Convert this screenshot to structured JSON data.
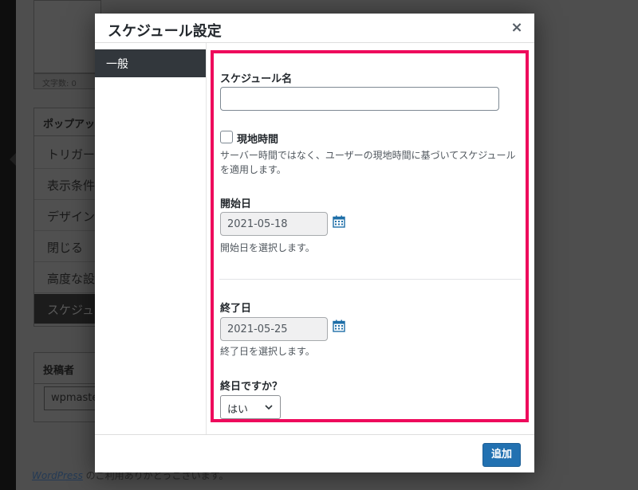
{
  "background": {
    "word_count": "文字数: 0",
    "popup_box_title": "ポップアップ",
    "tabs": [
      "トリガー",
      "表示条件",
      "デザイン",
      "閉じる",
      "高度な設",
      "スケジュ"
    ],
    "author_title": "投稿者",
    "author_value": "wpmaster",
    "footer_link": "WordPress",
    "footer_text": " のご利用ありがとうございます。"
  },
  "modal": {
    "title": "スケジュール設定",
    "close_icon": "×",
    "sidebar": {
      "items": [
        {
          "label": "一般"
        }
      ]
    },
    "fields": {
      "schedule_name": {
        "label": "スケジュール名",
        "value": ""
      },
      "local_time": {
        "label": "現地時間",
        "checked": false,
        "description": "サーバー時間ではなく、ユーザーの現地時間に基づいてスケジュールを適用します。"
      },
      "start_date": {
        "label": "開始日",
        "value": "2021-05-18",
        "description": "開始日を選択します。"
      },
      "end_date": {
        "label": "終了日",
        "value": "2021-05-25",
        "description": "終了日を選択します。"
      },
      "all_day": {
        "label": "終日ですか？",
        "selected": "はい"
      }
    },
    "add_button": "追加",
    "icons": {
      "calendar": "calendar-icon",
      "chevron": "chevron-down-icon",
      "close": "close-icon"
    },
    "colors": {
      "highlight": "#ee0a5c",
      "primary": "#2271b1",
      "sidebar_active": "#32373c",
      "calendar": "#1e6fa8"
    }
  }
}
